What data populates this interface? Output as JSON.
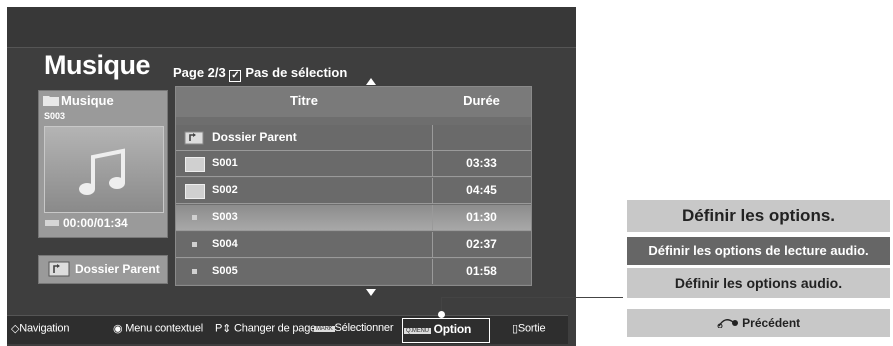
{
  "screen": {
    "title": "Musique",
    "page_info": "Page 2/3",
    "selection_status": "Pas de sélection"
  },
  "left_panel": {
    "folder_label": "Musique",
    "current_track": "S003",
    "time": "00:00/01:34",
    "parent_button": "Dossier Parent"
  },
  "table": {
    "headers": {
      "title": "Titre",
      "duration": "Durée"
    },
    "rows": [
      {
        "name": "Dossier Parent",
        "duration": "",
        "type": "parent"
      },
      {
        "name": "S001",
        "duration": "03:33",
        "type": "folder"
      },
      {
        "name": "S002",
        "duration": "04:45",
        "type": "folder"
      },
      {
        "name": "S003",
        "duration": "01:30",
        "type": "file",
        "selected": true
      },
      {
        "name": "S004",
        "duration": "02:37",
        "type": "file"
      },
      {
        "name": "S005",
        "duration": "01:58",
        "type": "file"
      }
    ]
  },
  "bottom_bar": {
    "navigation": "Navigation",
    "context_menu": "Menu contextuel",
    "page_change": "Changer de page",
    "select": "Sélectionner",
    "option": "Option",
    "exit": "Sortie",
    "mark_badge": "MARK",
    "menu_badge": "Q.MENU",
    "page_prefix": "P"
  },
  "option_panel": {
    "title": "Définir les options.",
    "item_playback": "Définir les options de lecture audio.",
    "item_audio": "Définir les options audio.",
    "back": "Précédent"
  },
  "colors": {
    "tv_background": "#3e3e3e",
    "selected_row": "#9a9a9a",
    "panel_highlight": "#666666"
  }
}
